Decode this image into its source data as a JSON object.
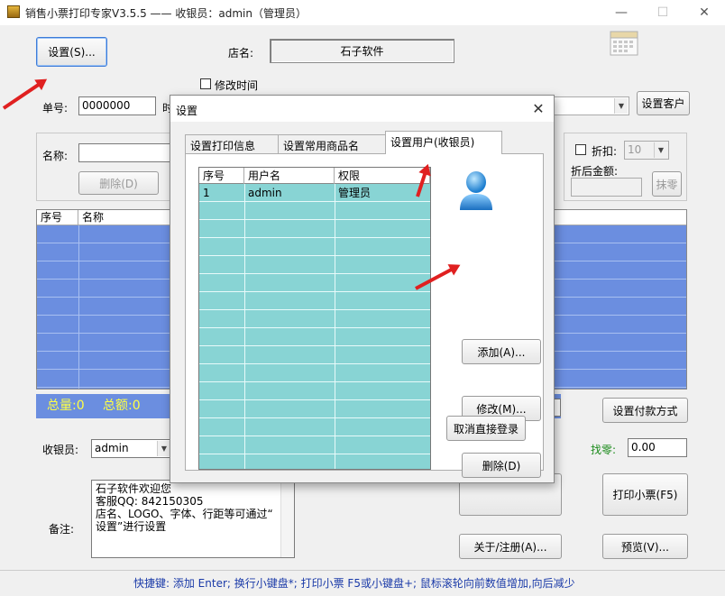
{
  "window": {
    "title": "销售小票打印专家V3.5.5 —— 收银员：admin（管理员）",
    "minimize_glyph": "—",
    "maximize_glyph": "☐",
    "close_glyph": "✕"
  },
  "toolbar": {
    "settings_label": "设置(S)...",
    "store_label": "店名:",
    "store_name": "石子软件",
    "modify_time_label": "修改时间",
    "calendar_icon": "calendar-icon"
  },
  "order": {
    "number_label": "单号:",
    "number_value": "0000000",
    "time_label_fragment": "时",
    "set_customer_label": "设置客户"
  },
  "product": {
    "name_label": "名称:",
    "delete_label": "删除(D)",
    "discount_label": "折扣:",
    "discount_value": "10",
    "after_discount_label": "折后金额:",
    "round_label": "抹零"
  },
  "items_table": {
    "columns": [
      "序号",
      "名称"
    ]
  },
  "summary": {
    "total_qty": "总量:0",
    "total_amount": "总额:0"
  },
  "payment": {
    "set_payment_label": "设置付款方式",
    "change_label": "找零:",
    "change_value": "0.00"
  },
  "cashier": {
    "label": "收银员:",
    "value": "admin"
  },
  "notes": {
    "label": "备注:",
    "lines": [
      "石子软件欢迎您",
      "客服QQ: 842150305",
      "店名、LOGO、字体、行距等可通过“",
      "设置”进行设置"
    ]
  },
  "actions": {
    "print_label": "打印小票(F5)",
    "about_label": "关于/注册(A)...",
    "preview_label": "预览(V)..."
  },
  "status_bar": {
    "text": "快捷键:  添加 Enter;  换行小键盘*;  打印小票 F5或小键盘+;  鼠标滚轮向前数值增加,向后减少"
  },
  "dialog": {
    "title": "设置",
    "close_glyph": "✕",
    "tabs": [
      {
        "label": "设置打印信息",
        "active": false
      },
      {
        "label": "设置常用商品名",
        "active": false
      },
      {
        "label": "设置用户(收银员)",
        "active": true
      }
    ],
    "users_table": {
      "columns": [
        "序号",
        "用户名",
        "权限"
      ],
      "rows": [
        {
          "index": "1",
          "username": "admin",
          "role": "管理员"
        }
      ]
    },
    "buttons": {
      "add": "添加(A)...",
      "modify": "修改(M)...",
      "delete": "删除(D)",
      "cancel_auto_login": "取消直接登录"
    }
  },
  "colors": {
    "table_blue": "#6b8ee0",
    "grid_teal": "#88d4d4",
    "summary_text": "#ffff44",
    "annotation_red": "#e02020"
  }
}
